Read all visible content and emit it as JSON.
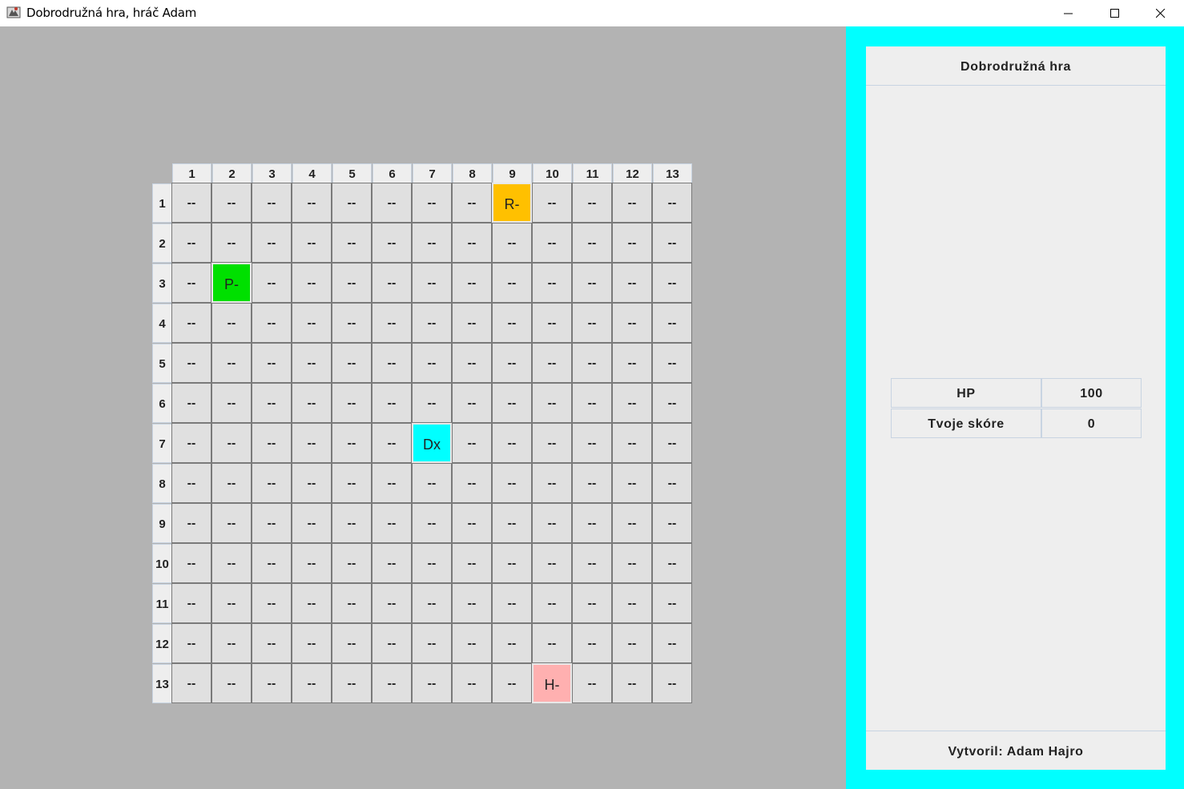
{
  "window": {
    "title": "Dobrodružná hra, hráč Adam",
    "app_icon": "game-controller-icon",
    "controls": {
      "minimize": "minimize-icon",
      "maximize": "maximize-icon",
      "close": "close-icon"
    }
  },
  "board": {
    "columns": [
      "1",
      "2",
      "3",
      "4",
      "5",
      "6",
      "7",
      "8",
      "9",
      "10",
      "11",
      "12",
      "13"
    ],
    "rows": [
      "1",
      "2",
      "3",
      "4",
      "5",
      "6",
      "7",
      "8",
      "9",
      "10",
      "11",
      "12",
      "13"
    ],
    "empty_symbol": "--",
    "entities": [
      {
        "label": "R-",
        "row": 1,
        "col": 9,
        "color": "#ffc000"
      },
      {
        "label": "P-",
        "row": 3,
        "col": 2,
        "color": "#00e000"
      },
      {
        "label": "Dx",
        "row": 7,
        "col": 7,
        "color": "#00ffff"
      },
      {
        "label": "H-",
        "row": 13,
        "col": 10,
        "color": "#ffb0b0"
      }
    ]
  },
  "side_panel": {
    "border_color": "#00ffff",
    "title": "Dobrodružná hra",
    "stats": [
      {
        "label": "HP",
        "value": "100"
      },
      {
        "label": "Tvoje skóre",
        "value": "0"
      }
    ],
    "footer": "Vytvoril: Adam Hajro"
  }
}
